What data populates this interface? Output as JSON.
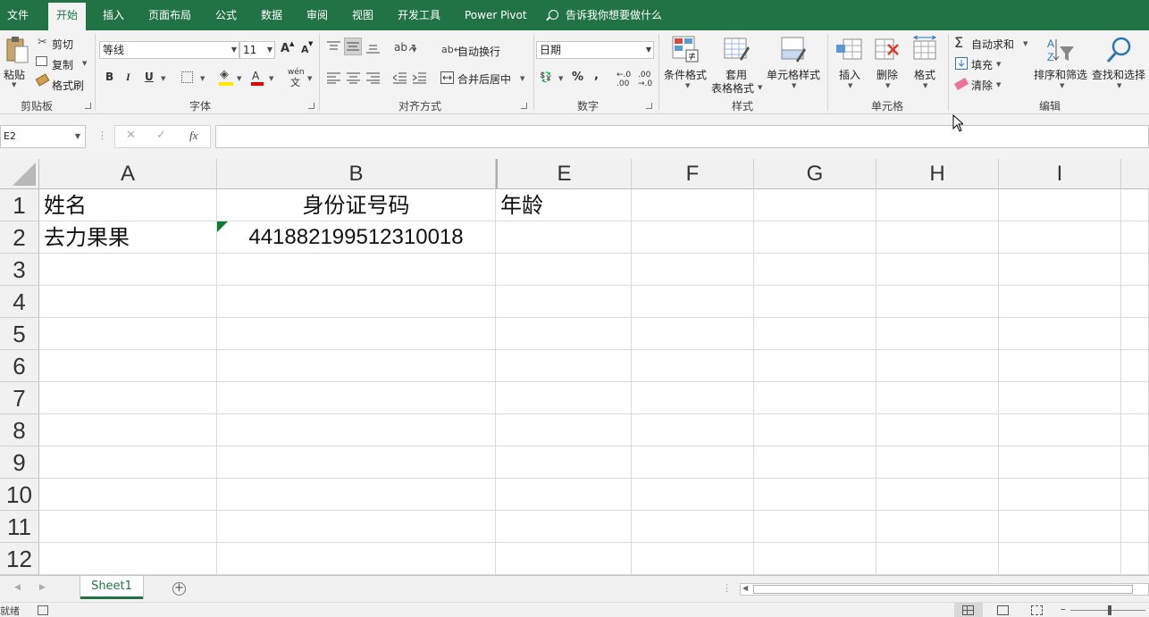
{
  "tabs": [
    "文件",
    "开始",
    "插入",
    "页面布局",
    "公式",
    "数据",
    "审阅",
    "视图",
    "开发工具",
    "Power Pivot"
  ],
  "tell_me": "告诉我你想要做什么",
  "clipboard": {
    "paste": "粘贴",
    "cut": "剪切",
    "copy": "复制",
    "painter": "格式刷",
    "group": "剪贴板"
  },
  "font": {
    "name": "等线",
    "size": "11",
    "bold": "B",
    "italic": "I",
    "underline": "U",
    "group": "字体",
    "grow": "A",
    "shrink": "A",
    "font_color": "A",
    "phonetic": "wén"
  },
  "align": {
    "wrap": "自动换行",
    "merge": "合并后居中",
    "group": "对齐方式"
  },
  "number": {
    "format": "日期",
    "percent": "%",
    "comma": ",",
    "group": "数字"
  },
  "styles": {
    "conditional": "条件格式",
    "table_1": "套用",
    "table_2": "表格格式",
    "cell_styles": "单元格样式",
    "group": "样式"
  },
  "cells": {
    "insert": "插入",
    "delete": "删除",
    "format": "格式",
    "group": "单元格"
  },
  "editing": {
    "autosum": "自动求和",
    "fill": "填充",
    "clear": "清除",
    "sort": "排序和筛选",
    "find": "查找和选择",
    "group": "编辑"
  },
  "formula_bar": {
    "name_box": "E2",
    "cancel": "✕",
    "enter": "✓",
    "fx": "fx",
    "value": ""
  },
  "columns": [
    "A",
    "B",
    "E",
    "F",
    "G",
    "H",
    "I"
  ],
  "rows": [
    "1",
    "2",
    "3",
    "4",
    "5",
    "6",
    "7",
    "8",
    "9",
    "10",
    "11",
    "12"
  ],
  "cells_data": {
    "A1": "姓名",
    "B1": "身份证号码",
    "E1": "年龄",
    "A2": "去力果果",
    "B2": "441882199512310018"
  },
  "sheet": {
    "name": "Sheet1",
    "add": "+"
  },
  "status": {
    "ready": "就绪"
  }
}
